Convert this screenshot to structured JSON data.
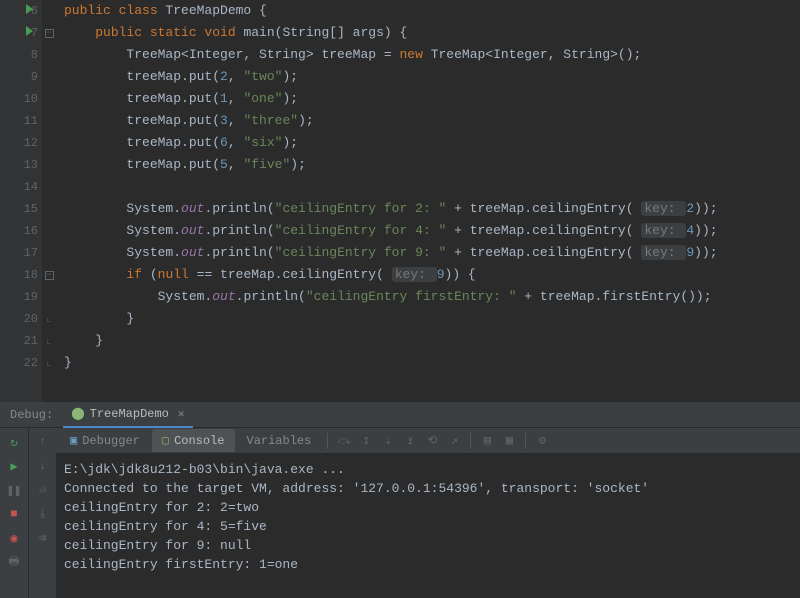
{
  "lineStart": 6,
  "code": [
    {
      "n": 6,
      "run": true,
      "fold": "none",
      "tokens": [
        [
          "kw",
          "public "
        ],
        [
          "kw",
          "class "
        ],
        [
          "cls",
          "TreeMapDemo "
        ],
        [
          "op",
          "{"
        ]
      ]
    },
    {
      "n": 7,
      "run": true,
      "fold": "open",
      "tokens": [
        [
          "op",
          "    "
        ],
        [
          "kw",
          "public static void "
        ],
        [
          "cls",
          "main"
        ],
        [
          "op",
          "(String[] args) {"
        ]
      ]
    },
    {
      "n": 8,
      "fold": "none",
      "tokens": [
        [
          "op",
          "        TreeMap<Integer, String> treeMap = "
        ],
        [
          "kw",
          "new "
        ],
        [
          "op",
          "TreeMap<Integer, String>();"
        ]
      ]
    },
    {
      "n": 9,
      "fold": "none",
      "tokens": [
        [
          "op",
          "        treeMap.put("
        ],
        [
          "num",
          "2"
        ],
        [
          "op",
          ", "
        ],
        [
          "str",
          "\"two\""
        ],
        [
          "op",
          ");"
        ]
      ]
    },
    {
      "n": 10,
      "fold": "none",
      "tokens": [
        [
          "op",
          "        treeMap.put("
        ],
        [
          "num",
          "1"
        ],
        [
          "op",
          ", "
        ],
        [
          "str",
          "\"one\""
        ],
        [
          "op",
          ");"
        ]
      ]
    },
    {
      "n": 11,
      "fold": "none",
      "tokens": [
        [
          "op",
          "        treeMap.put("
        ],
        [
          "num",
          "3"
        ],
        [
          "op",
          ", "
        ],
        [
          "str",
          "\"three\""
        ],
        [
          "op",
          ");"
        ]
      ]
    },
    {
      "n": 12,
      "fold": "none",
      "tokens": [
        [
          "op",
          "        treeMap.put("
        ],
        [
          "num",
          "6"
        ],
        [
          "op",
          ", "
        ],
        [
          "str",
          "\"six\""
        ],
        [
          "op",
          ");"
        ]
      ]
    },
    {
      "n": 13,
      "fold": "none",
      "tokens": [
        [
          "op",
          "        treeMap.put("
        ],
        [
          "num",
          "5"
        ],
        [
          "op",
          ", "
        ],
        [
          "str",
          "\"five\""
        ],
        [
          "op",
          ");"
        ]
      ]
    },
    {
      "n": 14,
      "fold": "none",
      "tokens": [
        [
          "op",
          ""
        ]
      ]
    },
    {
      "n": 15,
      "fold": "none",
      "tokens": [
        [
          "op",
          "        System."
        ],
        [
          "static-f",
          "out"
        ],
        [
          "op",
          ".println("
        ],
        [
          "str",
          "\"ceilingEntry for 2: \""
        ],
        [
          "op",
          " + treeMap.ceilingEntry( "
        ],
        [
          "hint",
          "key: "
        ],
        [
          "num",
          "2"
        ],
        [
          "op",
          "));"
        ]
      ]
    },
    {
      "n": 16,
      "fold": "none",
      "tokens": [
        [
          "op",
          "        System."
        ],
        [
          "static-f",
          "out"
        ],
        [
          "op",
          ".println("
        ],
        [
          "str",
          "\"ceilingEntry for 4: \""
        ],
        [
          "op",
          " + treeMap.ceilingEntry( "
        ],
        [
          "hint",
          "key: "
        ],
        [
          "num",
          "4"
        ],
        [
          "op",
          "));"
        ]
      ]
    },
    {
      "n": 17,
      "fold": "none",
      "tokens": [
        [
          "op",
          "        System."
        ],
        [
          "static-f",
          "out"
        ],
        [
          "op",
          ".println("
        ],
        [
          "str",
          "\"ceilingEntry for 9: \""
        ],
        [
          "op",
          " + treeMap.ceilingEntry( "
        ],
        [
          "hint",
          "key: "
        ],
        [
          "num",
          "9"
        ],
        [
          "op",
          "));"
        ]
      ]
    },
    {
      "n": 18,
      "fold": "open",
      "tokens": [
        [
          "op",
          "        "
        ],
        [
          "kw",
          "if "
        ],
        [
          "op",
          "("
        ],
        [
          "kw",
          "null "
        ],
        [
          "op",
          "== treeMap.ceilingEntry( "
        ],
        [
          "hint",
          "key: "
        ],
        [
          "num",
          "9"
        ],
        [
          "op",
          ")) {"
        ]
      ]
    },
    {
      "n": 19,
      "fold": "none",
      "tokens": [
        [
          "op",
          "            System."
        ],
        [
          "static-f",
          "out"
        ],
        [
          "op",
          ".println("
        ],
        [
          "str",
          "\"ceilingEntry firstEntry: \""
        ],
        [
          "op",
          " + treeMap.firstEntry());"
        ]
      ]
    },
    {
      "n": 20,
      "fold": "close",
      "tokens": [
        [
          "op",
          "        }"
        ]
      ]
    },
    {
      "n": 21,
      "fold": "close",
      "tokens": [
        [
          "op",
          "    }"
        ]
      ]
    },
    {
      "n": 22,
      "fold": "close",
      "tokens": [
        [
          "op",
          "}"
        ]
      ]
    }
  ],
  "debug": {
    "label": "Debug:",
    "tab": "TreeMapDemo",
    "tool_tabs": {
      "debugger": "Debugger",
      "console": "Console",
      "variables": "Variables"
    },
    "toolbar_icons": [
      "↻",
      "▶",
      "■",
      "⬓",
      "⇅",
      "⇥",
      "⤓",
      "↓",
      "⤒",
      "↗",
      "✗",
      "≣",
      "▦",
      "⚙"
    ],
    "left_strip1": [
      "↻",
      "▶",
      "■",
      "⬓",
      "⎋",
      "⎙"
    ],
    "left_strip2": [
      "↑",
      "↓",
      "⌫",
      "↲",
      "⇲"
    ]
  },
  "console": [
    "E:\\jdk\\jdk8u212-b03\\bin\\java.exe ...",
    "Connected to the target VM, address: '127.0.0.1:54396', transport: 'socket'",
    "ceilingEntry for 2: 2=two",
    "ceilingEntry for 4: 5=five",
    "ceilingEntry for 9: null",
    "ceilingEntry firstEntry: 1=one"
  ]
}
